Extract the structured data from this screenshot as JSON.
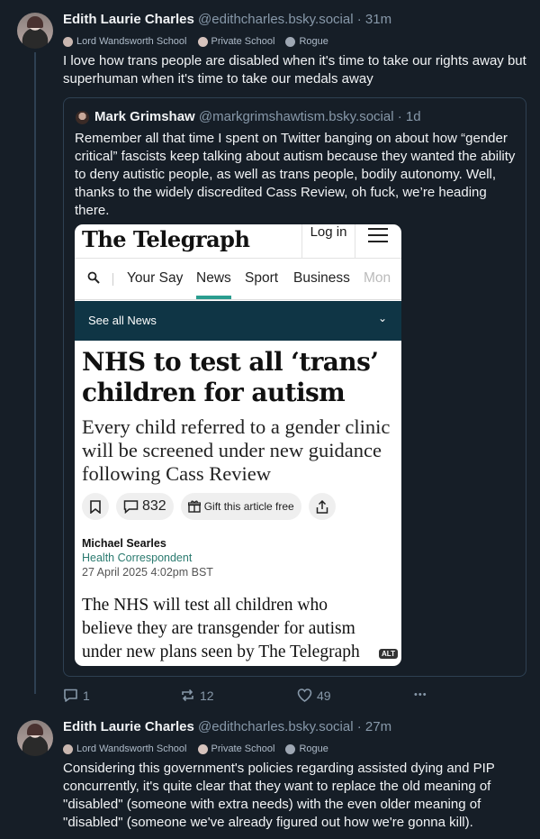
{
  "post1": {
    "author_name": "Edith Laurie Charles",
    "handle": "@edithcharles.bsky.social",
    "separator": "·",
    "time": "31m",
    "badges": [
      "Lord Wandsworth School",
      "Private School",
      "Rogue"
    ],
    "text": "I love how trans people are disabled when it's time to take our rights away but superhuman when it's time to take our medals away"
  },
  "quote": {
    "author_name": "Mark Grimshaw",
    "handle": "@markgrimshawtism.bsky.social",
    "separator": "·",
    "time": "1d",
    "text": "Remember all that time I spent on Twitter banging on about how “gender critical” fascists keep talking about autism because they wanted the ability to deny autistic people, as well as trans people, bodily autonomy. Well, thanks to the widely discredited Cass Review, oh fuck, we’re heading there.",
    "embed": {
      "logo": "The Telegraph",
      "login": "Log in",
      "nav": [
        "Your Say",
        "News",
        "Sport",
        "Business",
        "Mon"
      ],
      "nav_active": "News",
      "section_bar": "See all News",
      "headline": "NHS to test all ‘trans’ children for autism",
      "standfirst": "Every child referred to a gender clinic will be screened under new guidance following Cass Review",
      "comment_count": "832",
      "gift_label": "Gift this article free",
      "author": "Michael Searles",
      "role": "Health Correspondent",
      "date": "27 April 2025 4:02pm BST",
      "body_lines": [
        "The NHS will test all children who",
        "believe they are transgender for autism",
        "under new plans seen by The Telegraph"
      ],
      "alt_badge": "ALT"
    }
  },
  "post1_actions": {
    "replies": "1",
    "reposts": "12",
    "likes": "49",
    "more": "•••"
  },
  "post2": {
    "author_name": "Edith Laurie Charles",
    "handle": "@edithcharles.bsky.social",
    "separator": "·",
    "time": "27m",
    "badges": [
      "Lord Wandsworth School",
      "Private School",
      "Rogue"
    ],
    "text": "Considering this government's policies regarding assisted dying and PIP concurrently, it's quite clear that they want to replace the old meaning of \"disabled\" (someone with extra needs) with the even older meaning of \"disabled\" (someone we've already figured out how we're gonna kill)."
  },
  "colors": {
    "background": "#161e27",
    "thread_line": "#2e4052",
    "muted": "#8798a9",
    "telegraph_bar": "#0f3545",
    "telegraph_accent": "#2a9d8f"
  }
}
